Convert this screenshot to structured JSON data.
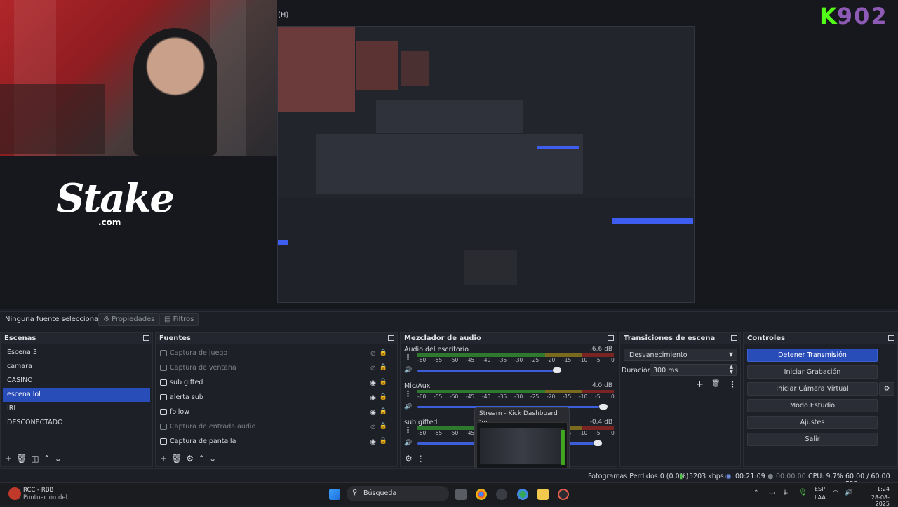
{
  "window": {
    "title_fragment": "(H)"
  },
  "preview": {
    "stake_logo": "Stake",
    "stake_sub": ".com",
    "kick_k": "K",
    "kick_num": "902"
  },
  "toolbar": {
    "no_source": "Ninguna fuente seleccionac",
    "properties": "Propiedades",
    "filters": "Filtros"
  },
  "scenes": {
    "title": "Escenas",
    "items": [
      "Escena 3",
      "camara",
      "CASINO",
      "escena lol",
      "IRL",
      "DESCONECTADO"
    ],
    "active_index": 3
  },
  "sources": {
    "title": "Fuentes",
    "items": [
      {
        "label": "Captura de juego",
        "dim": true
      },
      {
        "label": "Captura de ventana",
        "dim": true
      },
      {
        "label": "sub gifted",
        "dim": false
      },
      {
        "label": "alerta sub",
        "dim": false
      },
      {
        "label": "follow",
        "dim": false
      },
      {
        "label": "Captura de entrada audio",
        "dim": true
      },
      {
        "label": "Captura de pantalla",
        "dim": false
      }
    ]
  },
  "mixer": {
    "title": "Mezclador de audio",
    "ticks": [
      "-60",
      "-55",
      "-50",
      "-45",
      "-40",
      "-35",
      "-30",
      "-25",
      "-20",
      "-15",
      "-10",
      "-5",
      "0"
    ],
    "tracks": [
      {
        "name": "Audio del escritorio",
        "db": "-6.6 dB",
        "level": 0.73
      },
      {
        "name": "Mic/Aux",
        "db": "4.0 dB",
        "level": 0.98
      },
      {
        "name": "sub gifted",
        "db": "-0.4 dB",
        "level": 0.95
      }
    ]
  },
  "transitions": {
    "title": "Transiciones de escena",
    "selected": "Desvanecimiento",
    "duration_label": "Duración",
    "duration_value": "300 ms"
  },
  "controls": {
    "title": "Controles",
    "buttons": [
      "Detener Transmisión",
      "Iniciar Grabación",
      "Iniciar Cámara Virtual",
      "Modo Estudio",
      "Ajustes",
      "Salir"
    ]
  },
  "status": {
    "dropped": "Fotogramas Perdidos 0 (0.0%)",
    "bitrate": "5203 kbps",
    "stream_time": "00:21:09",
    "rec_time": "00:00:00",
    "cpu": "CPU: 9.7%",
    "fps": "60.00 / 60.00 FPS"
  },
  "notification": {
    "title": "Stream - Kick Dashboard -..."
  },
  "taskbar": {
    "app_name": "RCC - RBB",
    "app_sub": "Puntuación del...",
    "search": "Búsqueda",
    "lang1": "ESP",
    "lang2": "LAA",
    "time": "1:24",
    "date": "28-08-2025"
  },
  "colors": {
    "accent": "#284cb8",
    "kick_green": "#53fc18",
    "meter_green": "#2d7a2e"
  }
}
